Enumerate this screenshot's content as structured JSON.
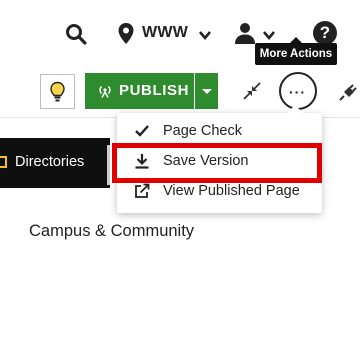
{
  "topbar": {
    "site_label": "WWW",
    "icons": [
      "search-icon",
      "location-pin-icon",
      "chevron-down-icon",
      "user-icon",
      "chevron-down-icon",
      "help-icon"
    ],
    "help_glyph": "?"
  },
  "tooltip": {
    "text": "More Actions"
  },
  "toolbar": {
    "publish_label": "PUBLISH",
    "more_glyph": "···",
    "colors": {
      "publish_green": "#2e8b2e",
      "bulb_yellow": "#f0c020"
    }
  },
  "nav": {
    "label": "Directories"
  },
  "page": {
    "heading": "Campus & Community"
  },
  "menu": {
    "items": [
      {
        "label": "Page Check",
        "icon": "checkmark-icon"
      },
      {
        "label": "Save Version",
        "icon": "download-icon"
      },
      {
        "label": "View Published Page",
        "icon": "external-link-icon"
      }
    ],
    "highlight_color": "#e00000"
  }
}
